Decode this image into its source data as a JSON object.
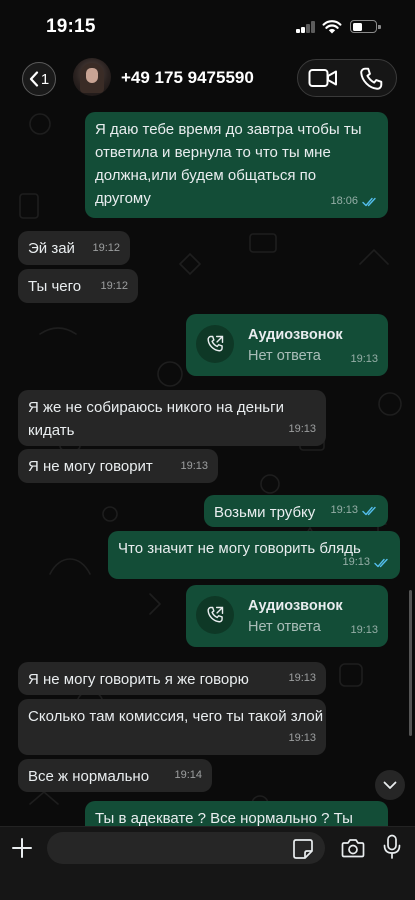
{
  "status_bar": {
    "time": "19:15"
  },
  "header": {
    "back_count": "1",
    "contact_name": "+49 175 9475590"
  },
  "messages": [
    {
      "text": "Я даю тебе время до завтра чтобы ты ответила и вернула то что ты мне должна,или будем общаться по другому",
      "time": "18:06",
      "read": true
    },
    {
      "text": "Эй зай",
      "time": "19:12"
    },
    {
      "text": "Ты чего",
      "time": "19:12"
    },
    {
      "title": "Аудиозвонок",
      "status": "Нет ответа",
      "time": "19:13"
    },
    {
      "text": "Я же не собираюсь никого на деньги кидать",
      "time": "19:13"
    },
    {
      "text": "Я не могу говорит",
      "time": "19:13"
    },
    {
      "text": "Возьми трубку",
      "time": "19:13",
      "read": true
    },
    {
      "text": "Что значит не могу говорить блядь",
      "time": "19:13",
      "read": true
    },
    {
      "title": "Аудиозвонок",
      "status": "Нет ответа",
      "time": "19:13"
    },
    {
      "text": "Я не могу говорить я же говорю",
      "time": "19:13"
    },
    {
      "text": "Сколько там комиссия, чего ты такой злой",
      "time": "19:13"
    },
    {
      "text": "Все ж нормально",
      "time": "19:14"
    },
    {
      "text": "Ты в адеквате ? Все нормально ? Ты"
    }
  ],
  "colors": {
    "background": "#0b0b0b",
    "incoming": "#262626",
    "outgoing": "#134d37",
    "read_tick": "#53bdeb"
  },
  "icons": [
    "back-chevron-icon",
    "video-camera-icon",
    "phone-icon",
    "missed-call-icon",
    "plus-icon",
    "sticker-icon",
    "camera-icon",
    "microphone-icon",
    "chevron-down-icon",
    "double-check-icon"
  ]
}
